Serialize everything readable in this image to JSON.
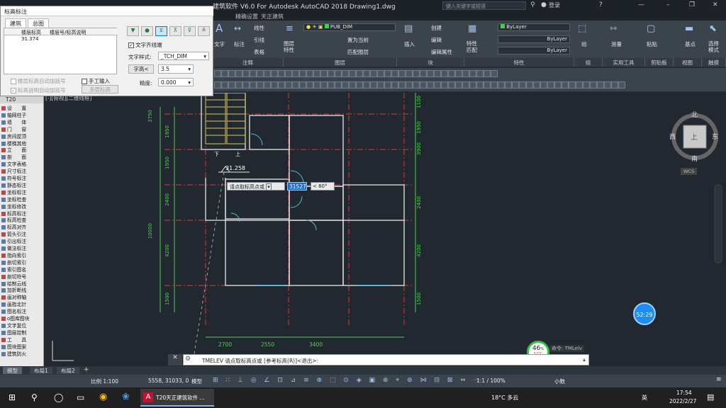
{
  "window": {
    "title": "建筑软件 V6.0 For Autodesk AutoCAD 2018    Drawing1.dwg",
    "search_placeholder": "键入关键字或短语",
    "login_label": "登录"
  },
  "menu": {
    "items": [
      "精确设置",
      "天正建筑"
    ]
  },
  "ribbon": {
    "text_label": "文字",
    "dim_label": "标注",
    "linear_label": "线性",
    "leader_label": "引线",
    "table_label": "表格",
    "layer_props_label": "图层\n特性",
    "layer_name": "PUB_DIM",
    "set_current_label": "置为当前",
    "match_layer_label": "匹配图层",
    "insert_label": "插入",
    "create_label": "创建",
    "edit_label": "编辑",
    "edit_attr_label": "编辑属性",
    "match_props_label": "特性\n匹配",
    "bylayer1": "ByLayer",
    "bylayer2": "ByLayer",
    "bylayer3": "ByLayer",
    "group_label": "组",
    "measure_label": "测量",
    "paste_label": "粘贴",
    "base_label": "基点",
    "select_label": "选择\n模式",
    "sections": [
      "注释",
      "图层",
      "块",
      "特性",
      "组",
      "实用工具",
      "剪贴板",
      "视图",
      "触摸"
    ]
  },
  "dialog": {
    "title": "标高标注",
    "tabs": [
      "建筑",
      "总图"
    ],
    "table_headers": [
      "楼层标高",
      "楼层号/标高说明"
    ],
    "table_rows": [
      [
        "31.374",
        ""
      ]
    ],
    "auto_add_floor": "楼层标高自动加括号",
    "manual_input": "手工输入",
    "auto_add_note": "标高说明自动加括号",
    "multi_floor_button": "多层标高",
    "text_after": "文字齐线端",
    "text_style_label": "文字样式:",
    "text_style_value": "_TCH_DIM",
    "char_height_button": "字高<",
    "char_height_value": "3.5",
    "precision_label": "精度:",
    "precision_value": "0.000"
  },
  "left_panel": {
    "header": "T20",
    "items": [
      "设　　置",
      "轴网柱子",
      "墙　　体",
      "门　　窗",
      "房间屋顶",
      "楼梯其他",
      "立　　面",
      "剖　　面",
      "文字表格",
      "尺寸标注",
      "符号标注",
      "静态标注",
      "坐标标注",
      "坐标检查",
      "坐标修改",
      "标高标注",
      "标高检查",
      "标高对齐",
      "箭头引注",
      "引出标注",
      "做法标注",
      "指向索引",
      "剖切索引",
      "索引图名",
      "剖切符号",
      "绘制云线",
      "加折断线",
      "画对称轴",
      "画指北针",
      "图名标注",
      "o图库图块",
      "文字复位",
      "图层控制",
      "工　　具",
      "图块图案",
      "建筑防火"
    ]
  },
  "drawing": {
    "view_label": "[-][俯视][二维线框]",
    "compass": {
      "north": "北",
      "south": "南",
      "east": "东",
      "west": "西",
      "top": "上"
    },
    "wcs_label": "WCS",
    "dims_left": [
      "3750",
      "1950",
      "1950",
      "2400",
      "4200",
      "1500"
    ],
    "dims_left2": [
      "10000"
    ],
    "dims_right": [
      "1100",
      "1950",
      "3900",
      "2400",
      "4200",
      "1500"
    ],
    "dims_bottom": [
      "2700",
      "2550",
      "3400"
    ],
    "elev_marker": "31.258",
    "tooltip_label": "请点取标高点或",
    "tooltip_value": "31527",
    "tooltip_angle": "< 80°",
    "stair_labels": [
      "下",
      "上"
    ],
    "timer": "52:29",
    "hw_percent": "46",
    "hw_temp": "52°C",
    "cmd_hint": "命令: TMLelv"
  },
  "command": {
    "text": "TMELEV 请点取标高点或 [参考标高(R)]<退出>:"
  },
  "layout_tabs": [
    "模型",
    "布局1",
    "布局2"
  ],
  "status": {
    "scale": "比例 1:100",
    "coords": "5558, 31033, 0",
    "model": "模型",
    "annot_scale": "1:1 / 100%",
    "unit": "小数"
  },
  "taskbar": {
    "app_label": "T20天正建筑软件 ...",
    "weather": "18°C 多云",
    "ime": "英",
    "time": "17:54",
    "date": "2022/2/27"
  },
  "colors": {
    "dim_green": "#4fd04f",
    "axis_red": "#d23b3b",
    "wall_white": "#e8e8e8",
    "door_cyan": "#58b7d6",
    "stair_yellow": "#d8c75a",
    "accent": "#0a84ff"
  }
}
